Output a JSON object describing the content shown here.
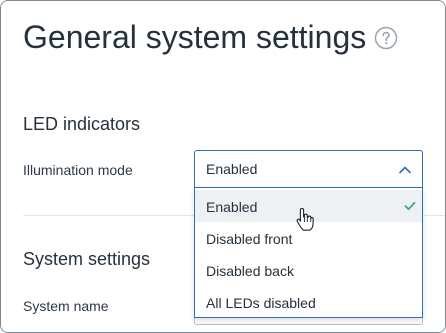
{
  "header": {
    "title": "General system settings",
    "help_icon": "question-circle-icon"
  },
  "led_section": {
    "title": "LED indicators",
    "illumination_label": "Illumination mode",
    "select_value": "Enabled",
    "chevron_icon": "chevron-up-icon"
  },
  "dropdown": {
    "options": [
      {
        "label": "Enabled",
        "selected": true
      },
      {
        "label": "Disabled front",
        "selected": false
      },
      {
        "label": "Disabled back",
        "selected": false
      },
      {
        "label": "All LEDs disabled",
        "selected": false
      }
    ],
    "check_icon": "check-icon",
    "check_color": "#3aaa7a"
  },
  "system_section": {
    "title": "System settings",
    "name_label": "System name"
  },
  "colors": {
    "accent": "#2f6fb5",
    "title_text": "#25313d"
  }
}
